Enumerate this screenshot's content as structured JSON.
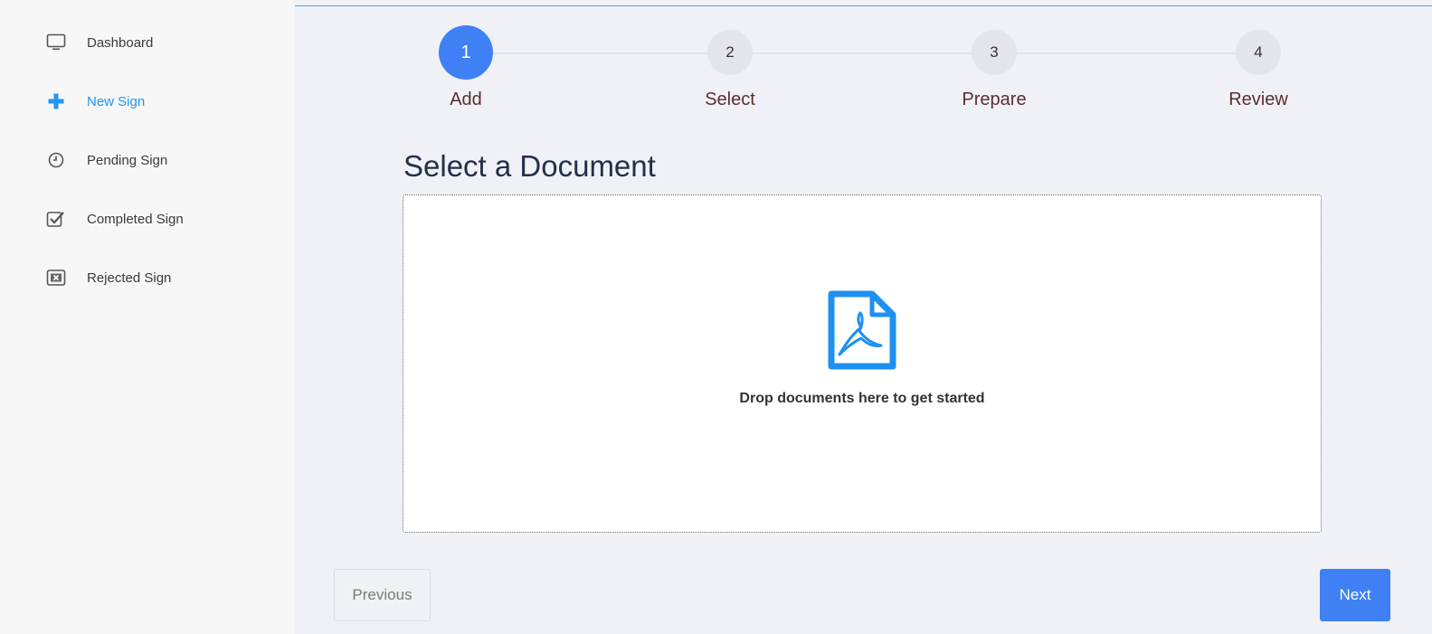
{
  "sidebar": {
    "items": [
      {
        "label": "Dashboard",
        "icon": "monitor-icon"
      },
      {
        "label": "New Sign",
        "icon": "plus-icon",
        "active": true
      },
      {
        "label": "Pending Sign",
        "icon": "clock-icon"
      },
      {
        "label": "Completed Sign",
        "icon": "checkbox-icon"
      },
      {
        "label": "Rejected Sign",
        "icon": "x-box-icon"
      }
    ]
  },
  "stepper": {
    "steps": [
      {
        "number": "1",
        "label": "Add",
        "active": true
      },
      {
        "number": "2",
        "label": "Select"
      },
      {
        "number": "3",
        "label": "Prepare"
      },
      {
        "number": "4",
        "label": "Review"
      }
    ]
  },
  "main": {
    "title": "Select a Document",
    "dropzone_text": "Drop documents here to get started"
  },
  "buttons": {
    "previous": "Previous",
    "next": "Next"
  },
  "colors": {
    "accent": "#3f80f5",
    "active_nav": "#2196f3",
    "pdf_icon": "#1e90f0"
  }
}
